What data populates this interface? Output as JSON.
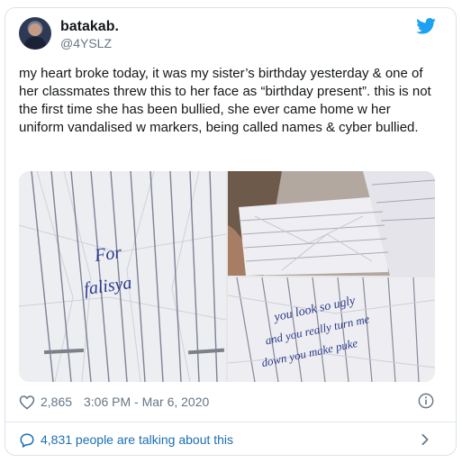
{
  "tweet": {
    "display_name": "batakab.",
    "handle": "@4YSLZ",
    "text": "my heart broke today, it was my sister’s birthday yesterday & one of her classmates threw this to her face as “birthday present”. this is not the first time she has been bullied, she ever came home w her uniform vandalised w markers, being called names & cyber bullied.",
    "likes": "2,865",
    "timestamp": "3:06 PM - Mar 6, 2020",
    "talking": "4,831 people are talking about this"
  },
  "media": {
    "note_left": [
      "For",
      "falisya"
    ],
    "note_right": [
      "you look so ugly",
      "and you really turn me",
      "down you make puke"
    ]
  },
  "colors": {
    "twitter_blue": "#1da1f2",
    "link_blue": "#1b6fb4",
    "text": "#14171a",
    "secondary": "#657786",
    "ink": "#2b3a8c"
  },
  "icons": {
    "brand": "twitter-bird-icon",
    "like": "heart-icon",
    "info": "info-icon",
    "conversation": "speech-bubble-icon",
    "more": "chevron-right-icon"
  }
}
